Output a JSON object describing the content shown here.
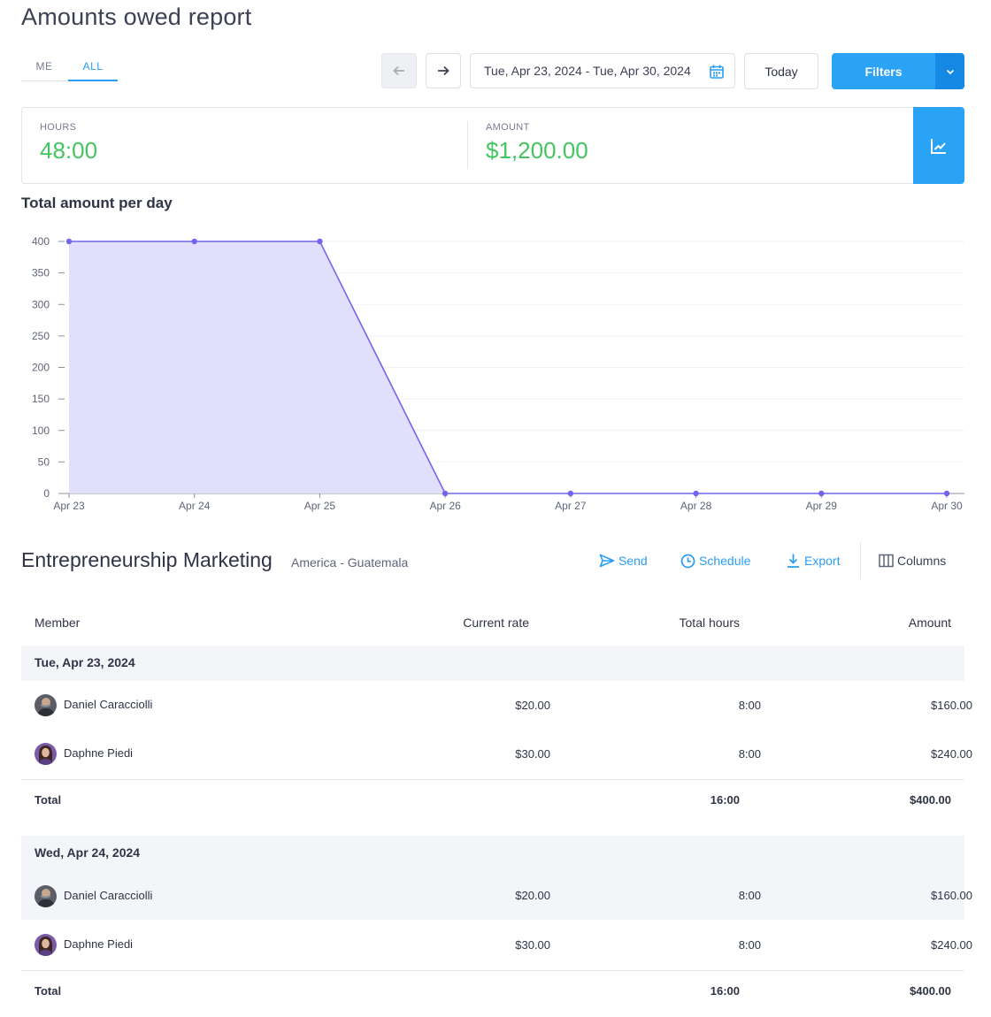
{
  "page": {
    "title": "Amounts owed report"
  },
  "segment": {
    "me_label": "ME",
    "all_label": "ALL",
    "active": "ALL"
  },
  "toolbar": {
    "date_range": "Tue, Apr 23, 2024 - Tue, Apr 30, 2024",
    "today_label": "Today",
    "filters_label": "Filters"
  },
  "summary": {
    "hours_label": "HOURS",
    "hours_value": "48:00",
    "amount_label": "AMOUNT",
    "amount_value": "$1,200.00"
  },
  "colors": {
    "accent": "#2aa3f7",
    "positive": "#43c660",
    "chart_line": "#7165f0",
    "chart_fill": "#e2dffd"
  },
  "chart_title": "Total amount per day",
  "chart_data": {
    "type": "area",
    "title": "Total amount per day",
    "categories": [
      "Apr 23",
      "Apr 24",
      "Apr 25",
      "Apr 26",
      "Apr 27",
      "Apr 28",
      "Apr 29",
      "Apr 30"
    ],
    "series": [
      {
        "values": [
          400,
          400,
          400,
          0,
          0,
          0,
          0,
          0
        ]
      }
    ],
    "yticks": [
      0,
      50,
      100,
      150,
      200,
      250,
      300,
      350,
      400
    ],
    "ylim": [
      0,
      400
    ],
    "grid": true
  },
  "project": {
    "name": "Entrepreneurship Marketing",
    "subtitle": "America - Guatemala",
    "actions": {
      "send": "Send",
      "schedule": "Schedule",
      "export": "Export",
      "columns": "Columns"
    }
  },
  "table": {
    "headers": {
      "member": "Member",
      "rate": "Current rate",
      "hours": "Total hours",
      "amount": "Amount"
    },
    "groups": [
      {
        "date": "Tue, Apr 23, 2024",
        "rows": [
          {
            "member": "Daniel Caracciolli",
            "rate": "$20.00",
            "hours": "8:00",
            "amount": "$160.00"
          },
          {
            "member": "Daphne Piedi",
            "rate": "$30.00",
            "hours": "8:00",
            "amount": "$240.00"
          }
        ],
        "total": {
          "label": "Total",
          "hours": "16:00",
          "amount": "$400.00"
        }
      },
      {
        "date": "Wed, Apr 24, 2024",
        "rows": [
          {
            "member": "Daniel Caracciolli",
            "rate": "$20.00",
            "hours": "8:00",
            "amount": "$160.00"
          },
          {
            "member": "Daphne Piedi",
            "rate": "$30.00",
            "hours": "8:00",
            "amount": "$240.00"
          }
        ],
        "total": {
          "label": "Total",
          "hours": "16:00",
          "amount": "$400.00"
        }
      }
    ]
  },
  "icons": {
    "prev": "arrow-left-icon",
    "next": "arrow-right-icon",
    "calendar": "calendar-icon",
    "filters_dropdown": "chevron-down-icon",
    "chart_toggle": "line-chart-icon",
    "send": "send-icon",
    "schedule": "clock-icon",
    "export": "download-icon",
    "columns": "columns-icon"
  }
}
